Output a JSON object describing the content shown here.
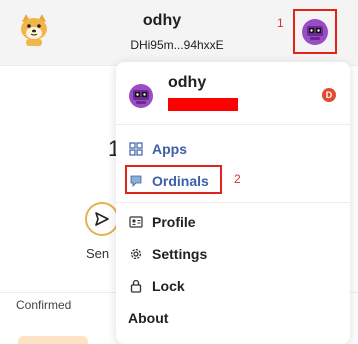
{
  "header": {
    "wallet_name": "odhy",
    "wallet_address": "DHi95m...94hxxE",
    "annotation_1": "1"
  },
  "background": {
    "send_label": "Sen",
    "partial_glyph": "1",
    "confirmed_label": "Confirmed"
  },
  "menu": {
    "user_name": "odhy",
    "chain_badge": "D",
    "items": [
      {
        "label": "Apps",
        "icon": "apps-icon"
      },
      {
        "label": "Ordinals",
        "icon": "ordinals-icon"
      },
      {
        "label": "Profile",
        "icon": "profile-icon"
      },
      {
        "label": "Settings",
        "icon": "gear-icon"
      },
      {
        "label": "Lock",
        "icon": "lock-icon"
      },
      {
        "label": "About",
        "icon": ""
      }
    ],
    "annotation_2": "2"
  },
  "colors": {
    "accent_blue": "#3d5fa8",
    "highlight_red": "#e2231a",
    "avatar_purple": "#8b3fb5",
    "chain_red": "#e24a2b"
  }
}
